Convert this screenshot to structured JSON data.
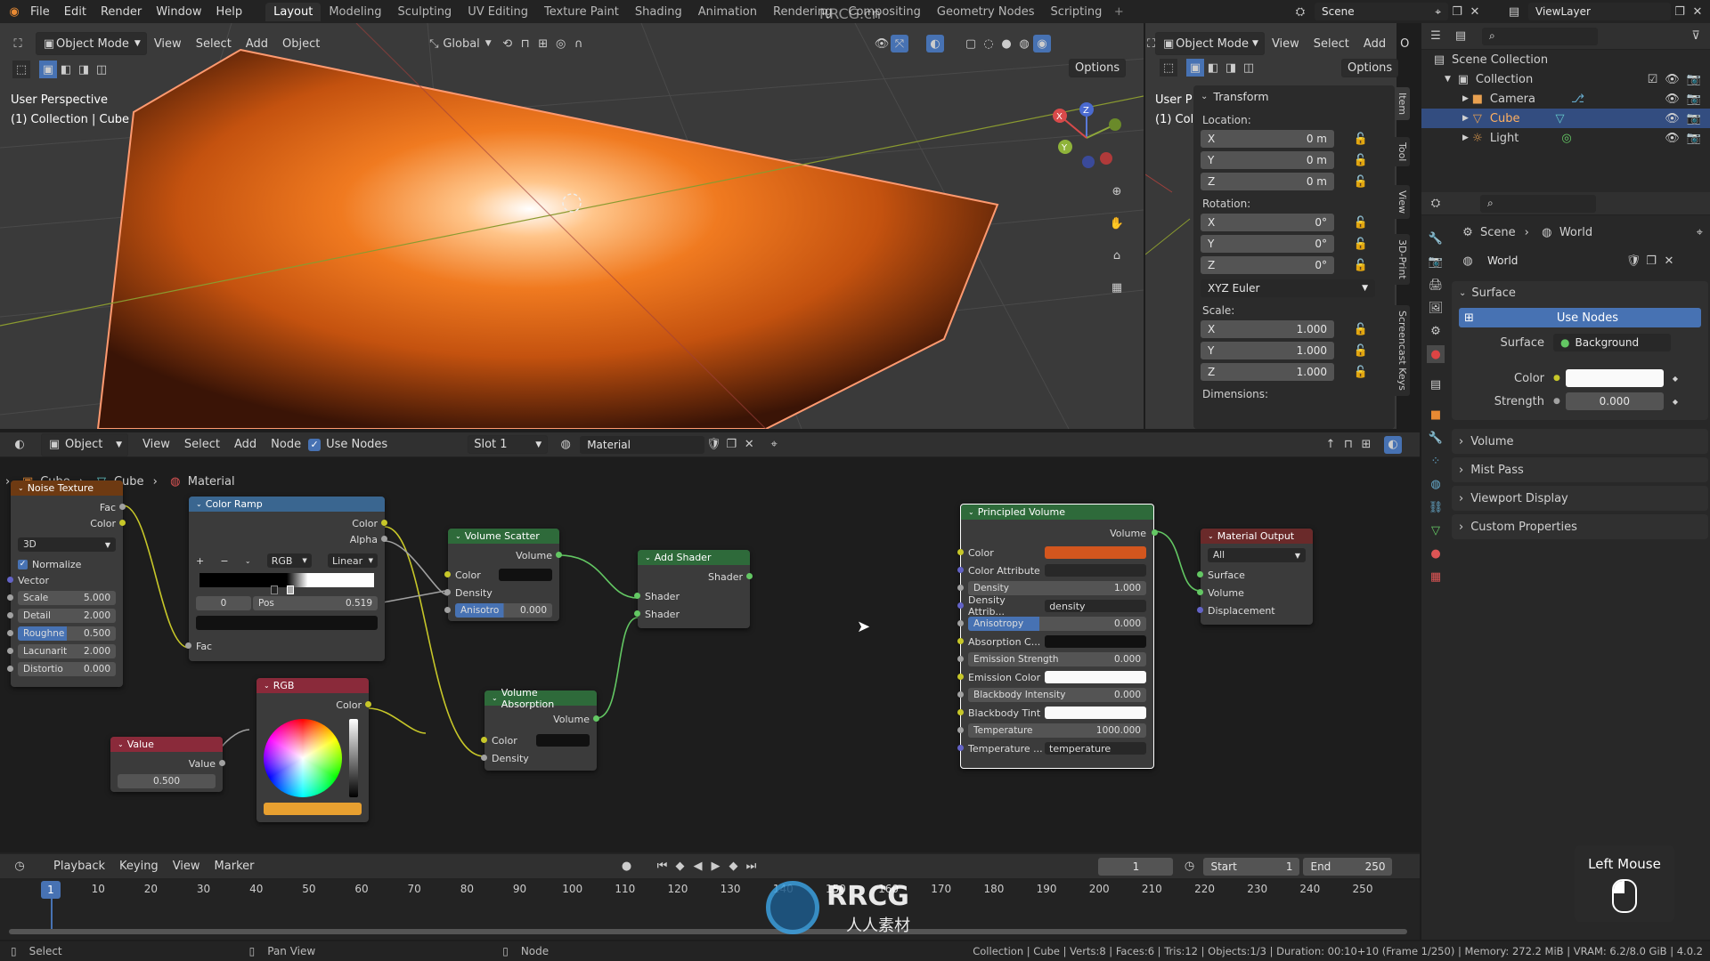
{
  "topbar": {
    "menus": [
      "File",
      "Edit",
      "Render",
      "Window",
      "Help"
    ],
    "workspaces": [
      "Layout",
      "Modeling",
      "Sculpting",
      "UV Editing",
      "Texture Paint",
      "Shading",
      "Animation",
      "Rendering",
      "Compositing",
      "Geometry Nodes",
      "Scripting"
    ],
    "active_workspace": "Layout",
    "scene": "Scene",
    "view_layer": "ViewLayer"
  },
  "viewport": {
    "mode": "Object Mode",
    "menus": [
      "View",
      "Select",
      "Add",
      "Object"
    ],
    "transform_orientation": "Global",
    "options": "Options",
    "title": "User Perspective",
    "subtitle": "(1) Collection | Cube",
    "axes": {
      "x": "X",
      "y": "Y",
      "z": "Z"
    }
  },
  "viewport2": {
    "mode": "Object Mode",
    "menus": [
      "View",
      "Select",
      "Add",
      "O"
    ],
    "options": "Options",
    "title": "User P",
    "subtitle": "(1) Col"
  },
  "npanel": {
    "tabs": [
      "Item",
      "Tool",
      "View",
      "3D-Print",
      "Screencast Keys"
    ],
    "transform_title": "Transform",
    "location_label": "Location:",
    "location": [
      {
        "axis": "X",
        "value": "0 m"
      },
      {
        "axis": "Y",
        "value": "0 m"
      },
      {
        "axis": "Z",
        "value": "0 m"
      }
    ],
    "rotation_label": "Rotation:",
    "rotation": [
      {
        "axis": "X",
        "value": "0°"
      },
      {
        "axis": "Y",
        "value": "0°"
      },
      {
        "axis": "Z",
        "value": "0°"
      }
    ],
    "rotation_mode": "XYZ Euler",
    "scale_label": "Scale:",
    "scale": [
      {
        "axis": "X",
        "value": "1.000"
      },
      {
        "axis": "Y",
        "value": "1.000"
      },
      {
        "axis": "Z",
        "value": "1.000"
      }
    ],
    "dimensions_label": "Dimensions:"
  },
  "outliner": {
    "root": "Scene Collection",
    "collection": "Collection",
    "items": [
      {
        "name": "Camera",
        "color": "#e8a050"
      },
      {
        "name": "Cube",
        "color": "#e8a050"
      },
      {
        "name": "Light",
        "color": "#e8a050"
      }
    ],
    "selected": "Cube"
  },
  "properties": {
    "breadcrumb_scene": "Scene",
    "breadcrumb_world": "World",
    "world_name": "World",
    "surface_panel": "Surface",
    "use_nodes": "Use Nodes",
    "surface_label": "Surface",
    "surface_value": "Background",
    "color_label": "Color",
    "strength_label": "Strength",
    "strength_value": "0.000",
    "panels": [
      "Volume",
      "Mist Pass",
      "Viewport Display",
      "Custom Properties"
    ]
  },
  "node_editor": {
    "type": "Object",
    "menus": [
      "View",
      "Select",
      "Add",
      "Node"
    ],
    "use_nodes": "Use Nodes",
    "slot": "Slot 1",
    "material": "Material",
    "breadcrumb": [
      "Cube",
      "Cube",
      "Material"
    ]
  },
  "nodes": {
    "noise": {
      "title": "Noise Texture",
      "fac": "Fac",
      "color": "Color",
      "dim": "3D",
      "normalize": "Normalize",
      "vector": "Vector",
      "fields": [
        {
          "label": "Scale",
          "value": "5.000"
        },
        {
          "label": "Detail",
          "value": "2.000"
        },
        {
          "label": "Roughne",
          "value": "0.500"
        },
        {
          "label": "Lacunarit",
          "value": "2.000"
        },
        {
          "label": "Distortio",
          "value": "0.000"
        }
      ]
    },
    "color_ramp": {
      "title": "Color Ramp",
      "out_color": "Color",
      "out_alpha": "Alpha",
      "mode": "RGB",
      "interp": "Linear",
      "index": "0",
      "pos_label": "Pos",
      "pos_value": "0.519",
      "fac": "Fac"
    },
    "rgb": {
      "title": "RGB",
      "out": "Color",
      "swatch": "#e8a030"
    },
    "value": {
      "title": "Value",
      "out": "Value",
      "val": "0.500"
    },
    "volume_scatter": {
      "title": "Volume Scatter",
      "out": "Volume",
      "color": "Color",
      "density": "Density",
      "aniso_label": "Anisotro",
      "aniso_value": "0.000"
    },
    "volume_absorption": {
      "title": "Volume Absorption",
      "out": "Volume",
      "color": "Color",
      "density": "Density"
    },
    "add_shader": {
      "title": "Add Shader",
      "out": "Shader",
      "in1": "Shader",
      "in2": "Shader"
    },
    "principled_volume": {
      "title": "Principled Volume",
      "out": "Volume",
      "color": "Color",
      "color_attr": "Color Attribute",
      "density_label": "Density",
      "density_value": "1.000",
      "density_attr_label": "Density Attrib...",
      "density_attr_value": "density",
      "anisotropy_label": "Anisotropy",
      "anisotropy_value": "0.000",
      "absorption": "Absorption C...",
      "emission_strength_label": "Emission Strength",
      "emission_strength_value": "0.000",
      "emission_color": "Emission Color",
      "blackbody_label": "Blackbody Intensity",
      "blackbody_value": "0.000",
      "blackbody_tint": "Blackbody Tint",
      "temperature_label": "Temperature",
      "temperature_value": "1000.000",
      "temp_attr_label": "Temperature ...",
      "temp_attr_value": "temperature",
      "color_swatch": "#d2561e"
    },
    "material_output": {
      "title": "Material Output",
      "target": "All",
      "surface": "Surface",
      "volume": "Volume",
      "displacement": "Displacement"
    }
  },
  "timeline": {
    "menus": [
      "Playback",
      "Keying",
      "View",
      "Marker"
    ],
    "current_frame": "1",
    "start_label": "Start",
    "start": "1",
    "end_label": "End",
    "end": "250",
    "ticks": [
      "1",
      "10",
      "20",
      "30",
      "40",
      "50",
      "60",
      "70",
      "80",
      "90",
      "100",
      "110",
      "120",
      "130",
      "140",
      "150",
      "160",
      "170",
      "180",
      "190",
      "200",
      "210",
      "220",
      "230",
      "240",
      "250"
    ]
  },
  "statusbar": {
    "select": "Select",
    "pan": "Pan View",
    "node": "Node",
    "stats": "Collection | Cube | Verts:8 | Faces:6 | Tris:12 | Objects:1/3 | Duration: 00:10+10 (Frame 1/250) | Memory: 272.2 MiB | VRAM: 6.2/8.0 GiB | 4.0.2"
  },
  "overlay": {
    "left_mouse": "Left Mouse",
    "watermark": "RRCG",
    "watermark_sub": "人人素材",
    "watermark_top": "RRCG.cn"
  }
}
